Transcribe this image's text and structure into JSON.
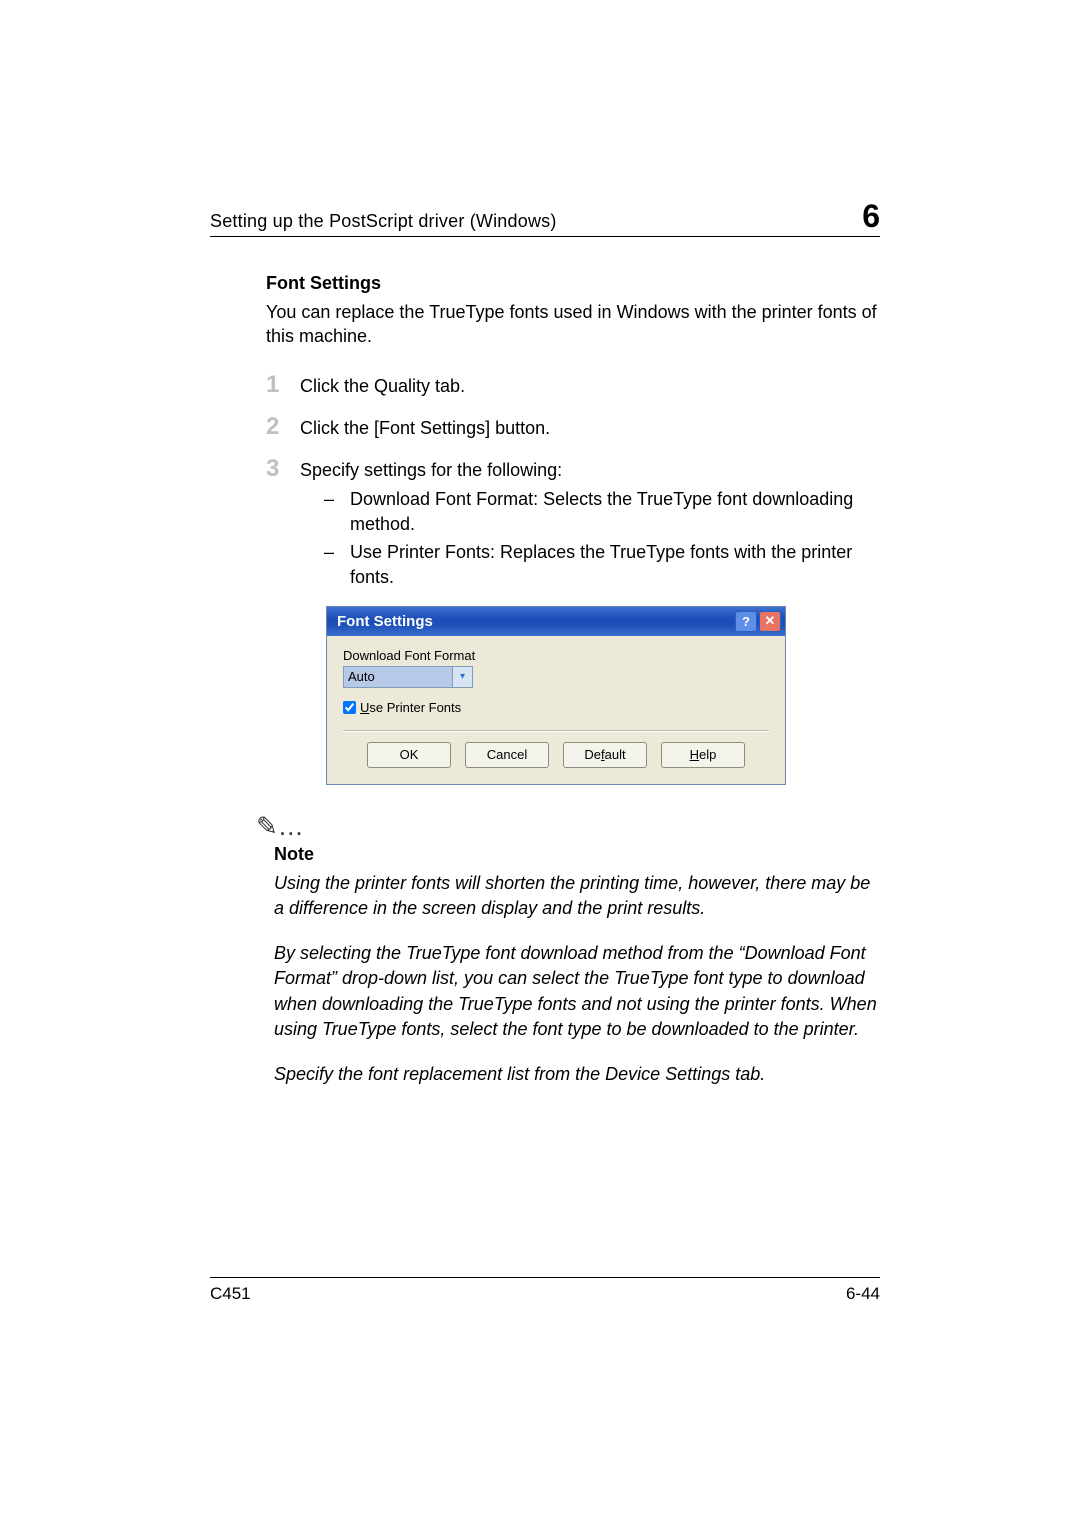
{
  "header": {
    "breadcrumb": "Setting up the PostScript driver (Windows)",
    "chapter_number": "6"
  },
  "section": {
    "title": "Font Settings",
    "intro": "You can replace the TrueType fonts used in Windows with the printer fonts of this machine."
  },
  "steps": {
    "s1_num": "1",
    "s1": "Click the Quality tab.",
    "s2_num": "2",
    "s2": "Click the [Font Settings] button.",
    "s3_num": "3",
    "s3": "Specify settings for the following:",
    "s3a_dash": "–",
    "s3a": "Download Font Format: Selects the TrueType font downloading method.",
    "s3b_dash": "–",
    "s3b": "Use Printer Fonts: Replaces the TrueType fonts with the printer fonts."
  },
  "dialog": {
    "title": "Font Settings",
    "help_glyph": "?",
    "close_glyph": "✕",
    "download_label": "Download Font Format",
    "download_value": "Auto",
    "arrow_glyph": "▾",
    "use_printer_label": "Use Printer Fonts",
    "use_printer_checked": true,
    "ok": "OK",
    "cancel": "Cancel",
    "default_btn": "Default",
    "help_btn": "Help"
  },
  "note": {
    "icon": "✎…",
    "heading": "Note",
    "p1": "Using the printer fonts will shorten the printing time, however, there may be a difference in the screen display and the print results.",
    "p2": "By selecting the TrueType font download method from the “Download Font Format” drop-down list, you can select the TrueType font type to download when downloading the TrueType fonts and not using the printer fonts. When using TrueType fonts, select the font type to be downloaded to the printer.",
    "p3": "Specify the font replacement list from the Device Settings tab."
  },
  "footer": {
    "model": "C451",
    "page": "6-44"
  }
}
